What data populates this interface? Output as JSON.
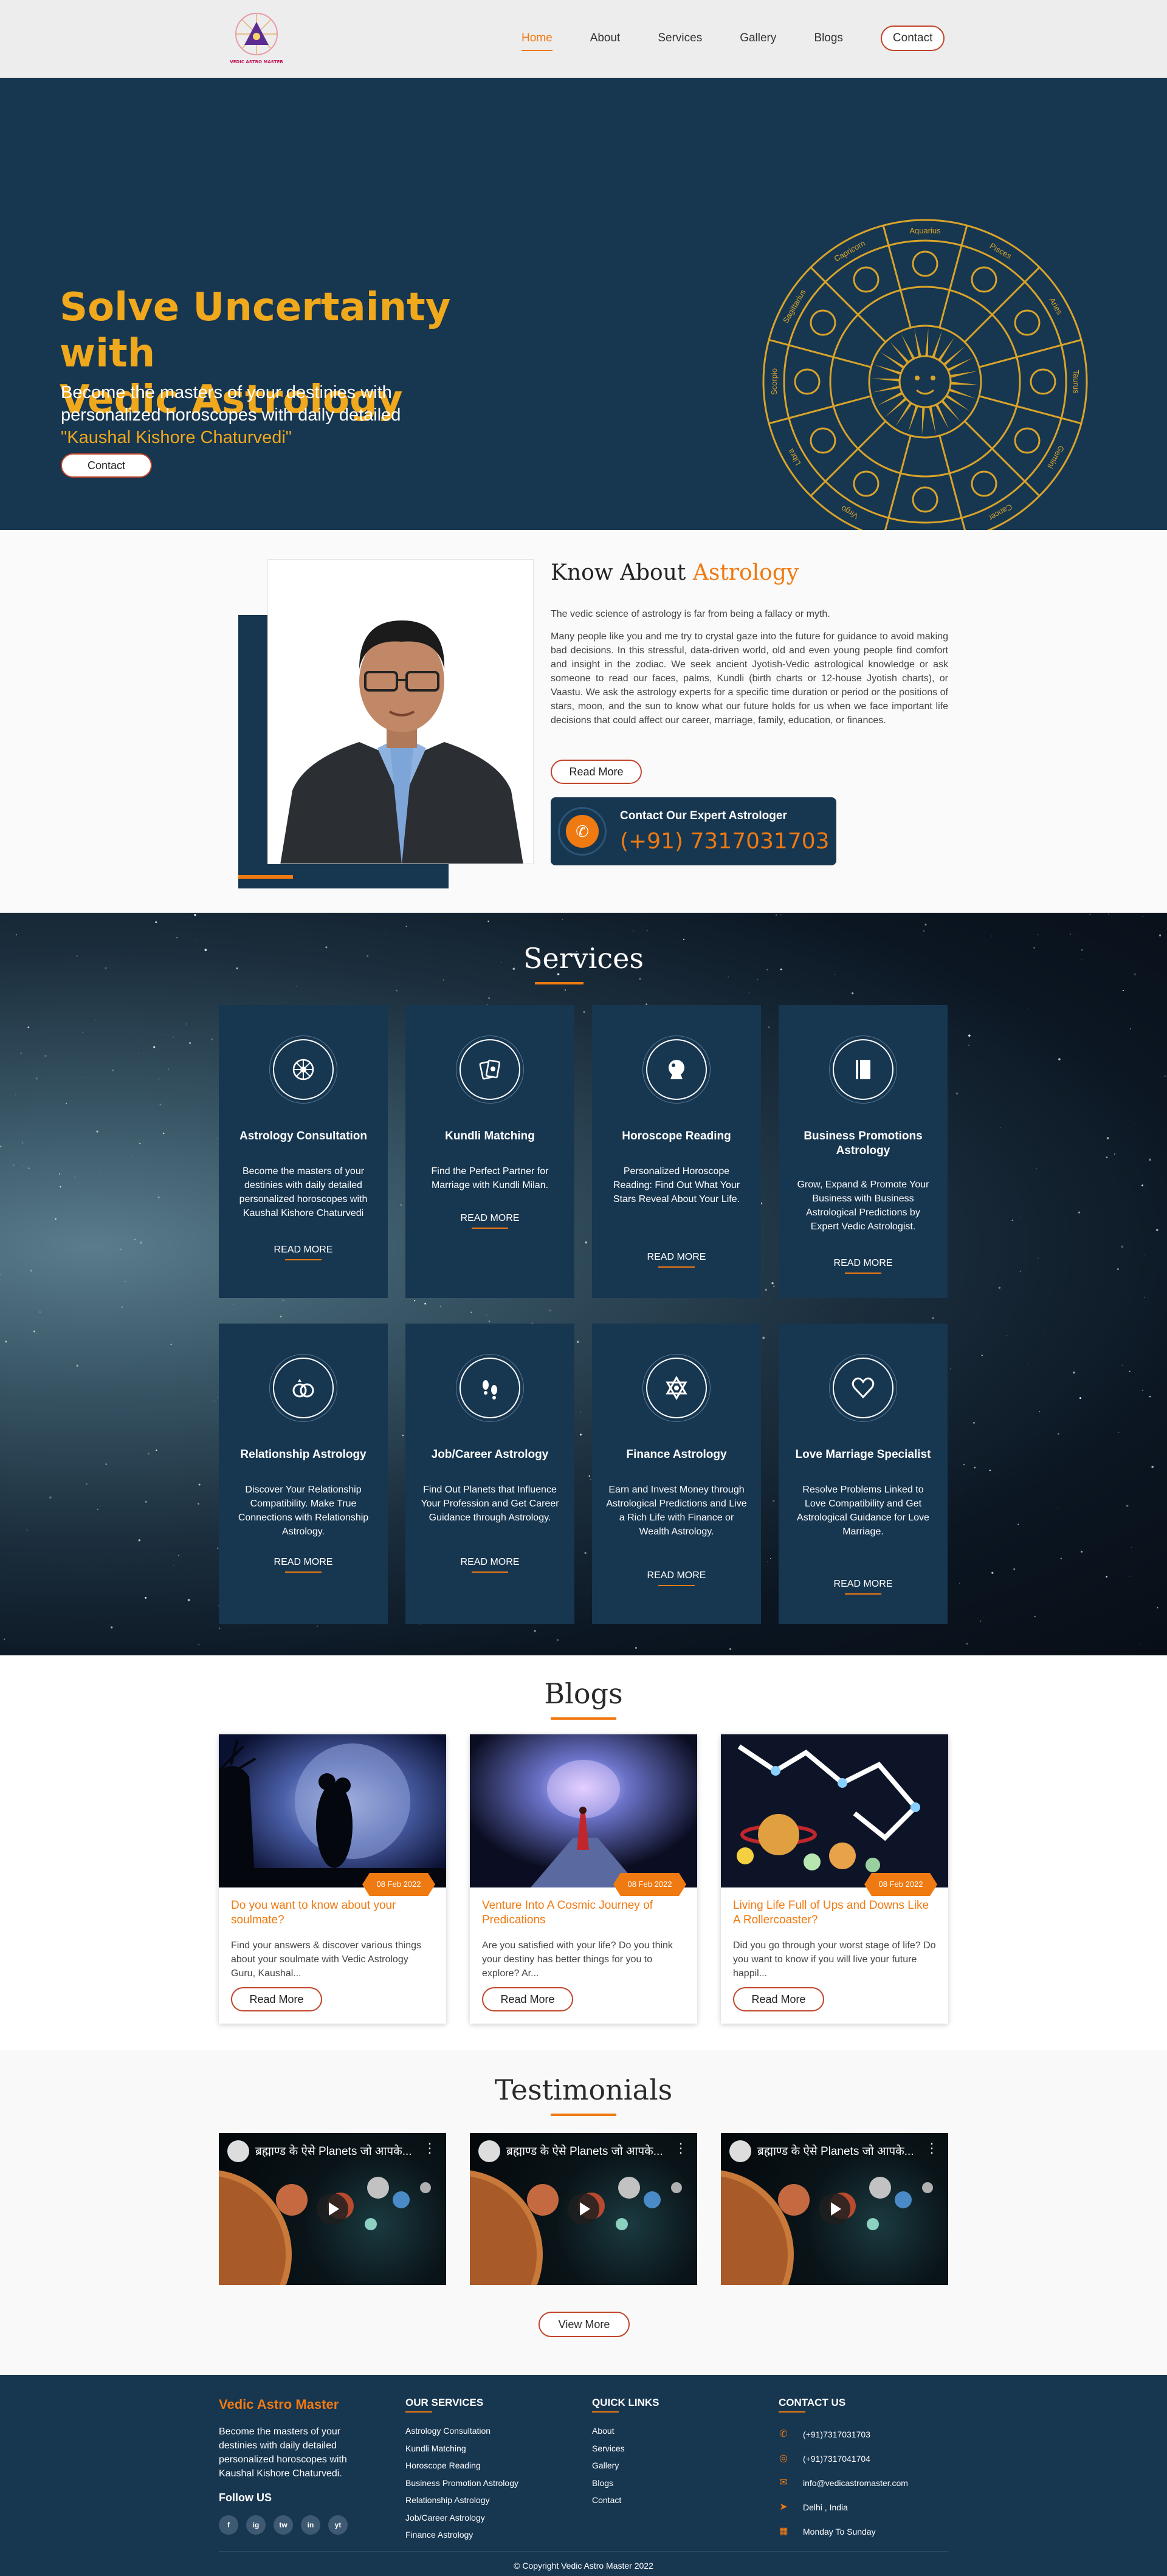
{
  "nav": {
    "logo_text": "VEDIC ASTRO MASTER",
    "items": [
      {
        "label": "Home",
        "active": true
      },
      {
        "label": "About"
      },
      {
        "label": "Services"
      },
      {
        "label": "Gallery"
      },
      {
        "label": "Blogs"
      },
      {
        "label": "Contact"
      }
    ]
  },
  "hero": {
    "title_line1": "Solve Uncertainty with",
    "title_line2": "Vedic Astrology",
    "subtitle": "Become the masters of your destinies with personalized horoscopes with daily detailed",
    "author": "\"Kaushal Kishore Chaturvedi\"",
    "button": "Contact",
    "zodiac_labels": [
      "Aquarius",
      "Pisces",
      "Aries",
      "Taurus",
      "Gemini",
      "Cancer",
      "Leo",
      "Virgo",
      "Libra",
      "Scorpio",
      "Sagittarius",
      "Capricorn"
    ]
  },
  "about": {
    "title_plain": "Know About",
    "title_accent": "Astrology",
    "intro": "The vedic science of astrology is far from being a fallacy or myth.",
    "body": "Many people like you and me try to crystal gaze into the future for guidance to avoid making bad decisions. In this stressful, data-driven world, old and even young people find comfort and insight in the zodiac. We seek ancient Jyotish-Vedic astrological knowledge or ask someone to read our faces, palms, Kundli (birth charts or 12-house Jyotish charts), or Vaastu. We ask the astrology experts for a specific time duration or period or the positions of stars, moon, and the sun to know what our future holds for us when we face important life decisions that could affect our career, marriage, family, education, or finances.",
    "button": "Read More",
    "contact_label": "Contact Our Expert Astrologer",
    "contact_phone": "(+91) 7317031703"
  },
  "services": {
    "title": "Services",
    "more_label": "READ MORE",
    "items": [
      {
        "title": "Astrology Consultation",
        "desc": "Become the masters of your destinies with daily detailed personalized horoscopes with Kaushal Kishore Chaturvedi",
        "icon": "wheel-icon"
      },
      {
        "title": "Kundli Matching",
        "desc": "Find the Perfect Partner for Marriage with Kundli Milan.",
        "icon": "cards-icon"
      },
      {
        "title": "Horoscope Reading",
        "desc": "Personalized Horoscope Reading: Find Out What Your Stars Reveal About Your Life.",
        "icon": "crystal-ball-icon"
      },
      {
        "title": "Business Promotions Astrology",
        "desc": "Grow, Expand & Promote Your Business with Business Astrological Predictions by Expert Vedic Astrologist.",
        "icon": "book-icon"
      },
      {
        "title": "Relationship Astrology",
        "desc": "Discover Your Relationship Compatibility. Make True Connections with Relationship Astrology.",
        "icon": "rings-icon"
      },
      {
        "title": "Job/Career Astrology",
        "desc": "Find Out Planets that Influence Your Profession and Get Career Guidance through Astrology.",
        "icon": "footprints-icon"
      },
      {
        "title": "Finance Astrology",
        "desc": "Earn and Invest Money through Astrological Predictions and Live a Rich Life with Finance or Wealth Astrology.",
        "icon": "star-icon"
      },
      {
        "title": "Love Marriage Specialist",
        "desc": "Resolve Problems Linked to Love Compatibility and Get Astrological Guidance for Love Marriage.",
        "icon": "heart-icon"
      }
    ]
  },
  "blogs": {
    "title": "Blogs",
    "button": "Read More",
    "items": [
      {
        "date": "08 Feb 2022",
        "title": "Do you want to know about your soulmate?",
        "desc": "Find your answers & discover various things about your soulmate with Vedic Astrology Guru, Kaushal..."
      },
      {
        "date": "08 Feb 2022",
        "title": "Venture Into A Cosmic Journey of Predications",
        "desc": "Are you satisfied with your life? Do you think your destiny has better things for you to explore? Ar..."
      },
      {
        "date": "08 Feb 2022",
        "title": "Living Life Full of Ups and Downs Like A Rollercoaster?",
        "desc": "Did you go through your worst stage of life? Do you want to know if you will live your future happil..."
      }
    ]
  },
  "testimonials": {
    "title": "Testimonials",
    "video_title": "ब्रह्माण्ड के ऐसे Planets जो आपके...",
    "button": "View More"
  },
  "footer": {
    "brand": "Vedic Astro Master",
    "desc": "Become the masters of your destinies with daily detailed personalized horoscopes with Kaushal Kishore Chaturvedi.",
    "follow": "Follow US",
    "social": [
      "f",
      "ig",
      "tw",
      "in",
      "yt"
    ],
    "services_title": "OUR SERVICES",
    "services": [
      "Astrology Consultation",
      "Kundli Matching",
      "Horoscope Reading",
      "Business Promotion Astrology",
      "Relationship Astrology",
      "Job/Career Astrology",
      "Finance Astrology"
    ],
    "links_title": "QUICK LINKS",
    "links": [
      "About",
      "Services",
      "Gallery",
      "Blogs",
      "Contact"
    ],
    "contact_title": "CONTACT US",
    "phone1": "(+91)7317031703",
    "phone2": "(+91)7317041704",
    "email": "info@vedicastromaster.com",
    "location": "Delhi , India",
    "hours": "Monday To Sunday",
    "copyright": "© Copyright Vedic Astro Master 2022"
  }
}
